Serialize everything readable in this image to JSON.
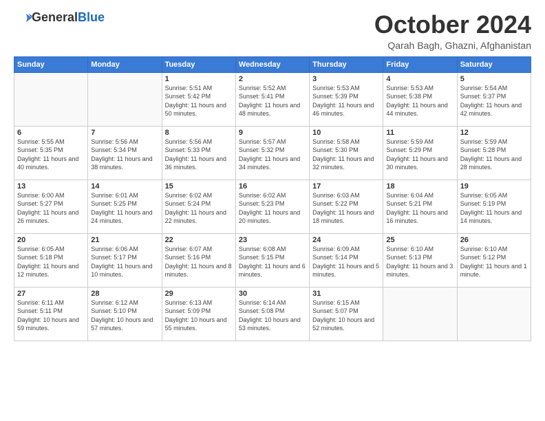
{
  "header": {
    "logo_general": "General",
    "logo_blue": "Blue",
    "month_title": "October 2024",
    "location": "Qarah Bagh, Ghazni, Afghanistan"
  },
  "weekdays": [
    "Sunday",
    "Monday",
    "Tuesday",
    "Wednesday",
    "Thursday",
    "Friday",
    "Saturday"
  ],
  "weeks": [
    [
      {
        "day": "",
        "info": ""
      },
      {
        "day": "",
        "info": ""
      },
      {
        "day": "1",
        "info": "Sunrise: 5:51 AM\nSunset: 5:42 PM\nDaylight: 11 hours and 50 minutes."
      },
      {
        "day": "2",
        "info": "Sunrise: 5:52 AM\nSunset: 5:41 PM\nDaylight: 11 hours and 48 minutes."
      },
      {
        "day": "3",
        "info": "Sunrise: 5:53 AM\nSunset: 5:39 PM\nDaylight: 11 hours and 46 minutes."
      },
      {
        "day": "4",
        "info": "Sunrise: 5:53 AM\nSunset: 5:38 PM\nDaylight: 11 hours and 44 minutes."
      },
      {
        "day": "5",
        "info": "Sunrise: 5:54 AM\nSunset: 5:37 PM\nDaylight: 11 hours and 42 minutes."
      }
    ],
    [
      {
        "day": "6",
        "info": "Sunrise: 5:55 AM\nSunset: 5:35 PM\nDaylight: 11 hours and 40 minutes."
      },
      {
        "day": "7",
        "info": "Sunrise: 5:56 AM\nSunset: 5:34 PM\nDaylight: 11 hours and 38 minutes."
      },
      {
        "day": "8",
        "info": "Sunrise: 5:56 AM\nSunset: 5:33 PM\nDaylight: 11 hours and 36 minutes."
      },
      {
        "day": "9",
        "info": "Sunrise: 5:57 AM\nSunset: 5:32 PM\nDaylight: 11 hours and 34 minutes."
      },
      {
        "day": "10",
        "info": "Sunrise: 5:58 AM\nSunset: 5:30 PM\nDaylight: 11 hours and 32 minutes."
      },
      {
        "day": "11",
        "info": "Sunrise: 5:59 AM\nSunset: 5:29 PM\nDaylight: 11 hours and 30 minutes."
      },
      {
        "day": "12",
        "info": "Sunrise: 5:59 AM\nSunset: 5:28 PM\nDaylight: 11 hours and 28 minutes."
      }
    ],
    [
      {
        "day": "13",
        "info": "Sunrise: 6:00 AM\nSunset: 5:27 PM\nDaylight: 11 hours and 26 minutes."
      },
      {
        "day": "14",
        "info": "Sunrise: 6:01 AM\nSunset: 5:25 PM\nDaylight: 11 hours and 24 minutes."
      },
      {
        "day": "15",
        "info": "Sunrise: 6:02 AM\nSunset: 5:24 PM\nDaylight: 11 hours and 22 minutes."
      },
      {
        "day": "16",
        "info": "Sunrise: 6:02 AM\nSunset: 5:23 PM\nDaylight: 11 hours and 20 minutes."
      },
      {
        "day": "17",
        "info": "Sunrise: 6:03 AM\nSunset: 5:22 PM\nDaylight: 11 hours and 18 minutes."
      },
      {
        "day": "18",
        "info": "Sunrise: 6:04 AM\nSunset: 5:21 PM\nDaylight: 11 hours and 16 minutes."
      },
      {
        "day": "19",
        "info": "Sunrise: 6:05 AM\nSunset: 5:19 PM\nDaylight: 11 hours and 14 minutes."
      }
    ],
    [
      {
        "day": "20",
        "info": "Sunrise: 6:05 AM\nSunset: 5:18 PM\nDaylight: 11 hours and 12 minutes."
      },
      {
        "day": "21",
        "info": "Sunrise: 6:06 AM\nSunset: 5:17 PM\nDaylight: 11 hours and 10 minutes."
      },
      {
        "day": "22",
        "info": "Sunrise: 6:07 AM\nSunset: 5:16 PM\nDaylight: 11 hours and 8 minutes."
      },
      {
        "day": "23",
        "info": "Sunrise: 6:08 AM\nSunset: 5:15 PM\nDaylight: 11 hours and 6 minutes."
      },
      {
        "day": "24",
        "info": "Sunrise: 6:09 AM\nSunset: 5:14 PM\nDaylight: 11 hours and 5 minutes."
      },
      {
        "day": "25",
        "info": "Sunrise: 6:10 AM\nSunset: 5:13 PM\nDaylight: 11 hours and 3 minutes."
      },
      {
        "day": "26",
        "info": "Sunrise: 6:10 AM\nSunset: 5:12 PM\nDaylight: 11 hours and 1 minute."
      }
    ],
    [
      {
        "day": "27",
        "info": "Sunrise: 6:11 AM\nSunset: 5:11 PM\nDaylight: 10 hours and 59 minutes."
      },
      {
        "day": "28",
        "info": "Sunrise: 6:12 AM\nSunset: 5:10 PM\nDaylight: 10 hours and 57 minutes."
      },
      {
        "day": "29",
        "info": "Sunrise: 6:13 AM\nSunset: 5:09 PM\nDaylight: 10 hours and 55 minutes."
      },
      {
        "day": "30",
        "info": "Sunrise: 6:14 AM\nSunset: 5:08 PM\nDaylight: 10 hours and 53 minutes."
      },
      {
        "day": "31",
        "info": "Sunrise: 6:15 AM\nSunset: 5:07 PM\nDaylight: 10 hours and 52 minutes."
      },
      {
        "day": "",
        "info": ""
      },
      {
        "day": "",
        "info": ""
      }
    ]
  ]
}
